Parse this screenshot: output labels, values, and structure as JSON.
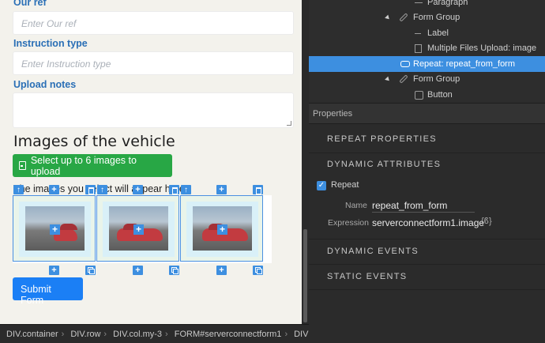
{
  "form": {
    "our_ref_label": "Our ref",
    "our_ref_placeholder": "Enter Our ref",
    "instruction_label": "Instruction type",
    "instruction_placeholder": "Enter Instruction type",
    "upload_notes_label": "Upload notes",
    "section_title": "Images of the vehicle",
    "upload_button": "Select up to 6 images to upload",
    "helper_text": "The images you select will appear here",
    "submit_button": "Submit Form"
  },
  "breadcrumb": [
    "DIV.container",
    "DIV.row",
    "DIV.col.my-3",
    "FORM#serverconnectform1",
    "DIV",
    "DI"
  ],
  "tree": {
    "items": [
      {
        "label": "Paragraph",
        "icon": "paragraph-icon"
      },
      {
        "label": "Form Group",
        "icon": "pencil-icon"
      },
      {
        "label": "Label",
        "icon": "line-icon"
      },
      {
        "label": "Multiple Files Upload: image",
        "icon": "document-icon"
      },
      {
        "label": "Repeat: repeat_from_form",
        "icon": "repeat-icon"
      },
      {
        "label": "Form Group",
        "icon": "pencil-icon"
      },
      {
        "label": "Button",
        "icon": "checkbox-icon"
      }
    ]
  },
  "properties": {
    "header": "Properties",
    "repeat_section": "REPEAT PROPERTIES",
    "dynamic_attrs": "DYNAMIC ATTRIBUTES",
    "repeat_label": "Repeat",
    "name_key": "Name",
    "name_value": "repeat_from_form",
    "expression_key": "Expression",
    "expression_value": "serverconnectform1.image",
    "expr_icon": "{ϐ}",
    "dynamic_events": "DYNAMIC EVENTS",
    "static_events": "STATIC EVENTS"
  },
  "colors": {
    "accent": "#3d8fe0",
    "success": "#28a745",
    "label": "#2a6fb6"
  }
}
